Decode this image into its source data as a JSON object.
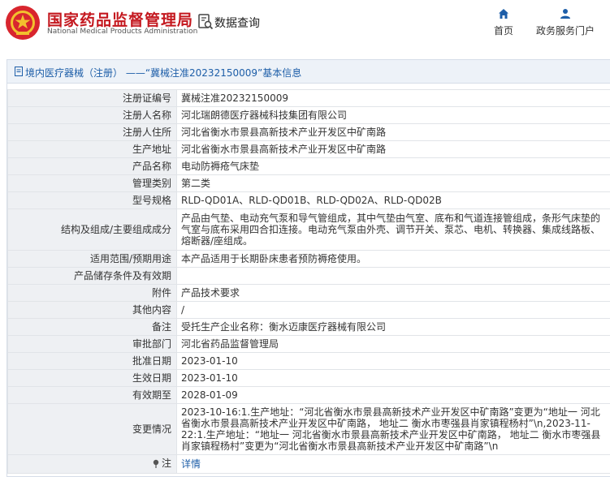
{
  "header": {
    "brand_cn": "国家药品监督管理局",
    "brand_en": "National Medical Products Administration",
    "query_label": "数据查询",
    "nav": {
      "home": "首页",
      "portal": "政务服务门户"
    }
  },
  "panel": {
    "title": "境内医疗器械（注册） ——“冀械注准20232150009”基本信息"
  },
  "rows": [
    {
      "label": "注册证编号",
      "value": "冀械注准20232150009"
    },
    {
      "label": "注册人名称",
      "value": "河北瑞朗德医疗器械科技集团有限公司"
    },
    {
      "label": "注册人住所",
      "value": "河北省衡水市景县高新技术产业开发区中矿南路"
    },
    {
      "label": "生产地址",
      "value": "河北省衡水市景县高新技术产业开发区中矿南路"
    },
    {
      "label": "产品名称",
      "value": "电动防褥疮气床垫"
    },
    {
      "label": "管理类别",
      "value": "第二类"
    },
    {
      "label": "型号规格",
      "value": "RLD-QD01A、RLD-QD01B、RLD-QD02A、RLD-QD02B"
    },
    {
      "label": "结构及组成/主要组成成分",
      "value": "产品由气垫、电动充气泵和导气管组成，其中气垫由气室、底布和气道连接管组成，条形气床垫的气室与底布采用四合扣连接。电动充气泵由外壳、调节开关、泵芯、电机、转换器、集成线路板、熔断器/座组成。"
    },
    {
      "label": "适用范围/预期用途",
      "value": "本产品适用于长期卧床患者预防褥疮使用。"
    },
    {
      "label": "产品储存条件及有效期",
      "value": ""
    },
    {
      "label": "附件",
      "value": "产品技术要求"
    },
    {
      "label": "其他内容",
      "value": "/"
    },
    {
      "label": "备注",
      "value": "受托生产企业名称：衡水迈康医疗器械有限公司"
    },
    {
      "label": "审批部门",
      "value": "河北省药品监督管理局"
    },
    {
      "label": "批准日期",
      "value": "2023-01-10"
    },
    {
      "label": "生效日期",
      "value": "2023-01-10"
    },
    {
      "label": "有效期至",
      "value": "2028-01-09"
    },
    {
      "label": "变更情况",
      "value": "2023-10-16:1.生产地址：“河北省衡水市景县高新技术产业开发区中矿南路”变更为“地址一 河北省衡水市景县高新技术产业开发区中矿南路， 地址二 衡水市枣强县肖家镇程杨村”\\n,2023-11-22:1.生产地址：“地址一 河北省衡水市景县高新技术产业开发区中矿南路， 地址二 衡水市枣强县肖家镇程杨村”变更为“河北省衡水市景县高新技术产业开发区中矿南路”\\n"
    }
  ],
  "note_row": {
    "label": "注",
    "link_text": "详情"
  },
  "colors": {
    "brand_red": "#c4181f",
    "link_blue": "#1d5ea8",
    "label_bg": "#eef0f3",
    "panel_head_bg": "#edf2f8"
  },
  "icons": {
    "logo": "national-emblem-logo",
    "query": "document-search-icon",
    "home": "home-icon",
    "portal": "user-icon",
    "panel": "document-icon",
    "note": "pin-icon"
  }
}
